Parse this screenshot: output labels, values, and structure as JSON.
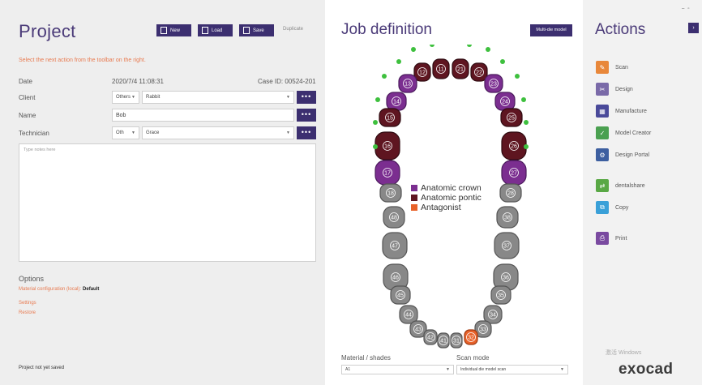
{
  "project": {
    "title": "Project",
    "toolbar": {
      "new_label": "New",
      "load_label": "Load",
      "save_label": "Save",
      "duplicate_label": "Duplicate"
    },
    "hint": "Select the next action from the toolbar on the right.",
    "date_label": "Date",
    "date_value": "2020/7/4 11:08:31",
    "case_id": "Case ID: 00524-201",
    "client_label": "Client",
    "client_prefix": "Others",
    "client_value": "Rabbit",
    "name_label": "Name",
    "name_value": "Bob",
    "technician_label": "Technician",
    "technician_prefix": "Oth",
    "technician_value": "Grace",
    "more_label": "•••",
    "notes_placeholder": "Type notes here",
    "options_title": "Options",
    "material_config_label": "Material configuration (local):",
    "material_config_value": "Default",
    "settings_link": "Settings",
    "restore_link": "Restore",
    "status": "Project not yet saved"
  },
  "job": {
    "title": "Job definition",
    "multi_die_label": "Multi-die model",
    "legend": [
      {
        "label": "Anatomic crown",
        "color": "#7b2e90"
      },
      {
        "label": "Anatomic pontic",
        "color": "#5e1520"
      },
      {
        "label": "Antagonist",
        "color": "#e8622a"
      }
    ],
    "upper_teeth": [
      {
        "num": "11",
        "state": "pontic"
      },
      {
        "num": "21",
        "state": "pontic"
      },
      {
        "num": "12",
        "state": "pontic"
      },
      {
        "num": "22",
        "state": "pontic"
      },
      {
        "num": "13",
        "state": "crown"
      },
      {
        "num": "23",
        "state": "crown"
      },
      {
        "num": "14",
        "state": "crown"
      },
      {
        "num": "24",
        "state": "crown"
      },
      {
        "num": "15",
        "state": "pontic"
      },
      {
        "num": "25",
        "state": "pontic"
      },
      {
        "num": "16",
        "state": "pontic"
      },
      {
        "num": "26",
        "state": "pontic"
      },
      {
        "num": "17",
        "state": "crown"
      },
      {
        "num": "27",
        "state": "crown"
      },
      {
        "num": "18",
        "state": "none"
      },
      {
        "num": "28",
        "state": "none"
      }
    ],
    "lower_teeth": [
      {
        "num": "48",
        "state": "none"
      },
      {
        "num": "38",
        "state": "none"
      },
      {
        "num": "47",
        "state": "none"
      },
      {
        "num": "37",
        "state": "none"
      },
      {
        "num": "46",
        "state": "none"
      },
      {
        "num": "36",
        "state": "none"
      },
      {
        "num": "45",
        "state": "none"
      },
      {
        "num": "35",
        "state": "none"
      },
      {
        "num": "44",
        "state": "none"
      },
      {
        "num": "34",
        "state": "none"
      },
      {
        "num": "43",
        "state": "none"
      },
      {
        "num": "33",
        "state": "none"
      },
      {
        "num": "42",
        "state": "none"
      },
      {
        "num": "41",
        "state": "none"
      },
      {
        "num": "31",
        "state": "none"
      },
      {
        "num": "32",
        "state": "antagonist"
      }
    ],
    "material_label": "Material / shades",
    "material_value": "A1",
    "scan_mode_label": "Scan mode",
    "scan_mode_value": "Individual die model scan"
  },
  "actions": {
    "title": "Actions",
    "collapse_label": "›",
    "items": [
      {
        "label": "Scan",
        "icon": "scanner-icon",
        "color": "#e8873a"
      },
      {
        "label": "Design",
        "icon": "design-icon",
        "color": "#7a6aa8"
      },
      {
        "label": "Manufacture",
        "icon": "manufacture-icon",
        "color": "#4a4a9a"
      },
      {
        "label": "Model Creator",
        "icon": "model-creator-icon",
        "color": "#4aa050"
      },
      {
        "label": "Design Portal",
        "icon": "design-portal-icon",
        "color": "#3d5fa0"
      },
      {
        "label": "dentalshare",
        "icon": "dentalshare-icon",
        "color": "#59a845"
      },
      {
        "label": "Copy",
        "icon": "copy-icon",
        "color": "#3aa0d8"
      },
      {
        "label": "Print",
        "icon": "print-icon",
        "color": "#7a4aa0"
      }
    ],
    "watermark": "激活 Windows",
    "brand": "exocad"
  },
  "colors": {
    "accent": "#3c2f70",
    "link": "#e87a50",
    "tooth_none": "#888888",
    "marker": "#3ec03e"
  }
}
